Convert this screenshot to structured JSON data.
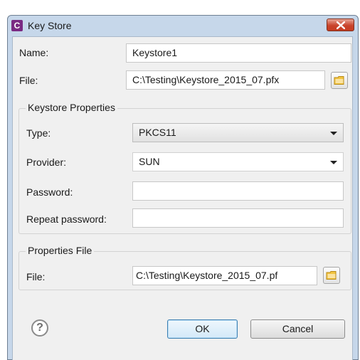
{
  "window": {
    "title": "Key Store",
    "app_icon_letter": "C"
  },
  "form": {
    "name_label": "Name:",
    "name_value": "Keystore1",
    "file_label": "File:",
    "file_value": "C:\\Testing\\Keystore_2015_07.pfx"
  },
  "keystore_properties": {
    "title": "Keystore Properties",
    "type_label": "Type:",
    "type_value": "PKCS11",
    "provider_label": "Provider:",
    "provider_value": "SUN",
    "password_label": "Password:",
    "password_value": "",
    "repeat_password_label": "Repeat password:",
    "repeat_password_value": ""
  },
  "properties_file": {
    "title": "Properties File",
    "file_label": "File:",
    "file_value": "C:\\Testing\\Keystore_2015_07.pf"
  },
  "buttons": {
    "help": "?",
    "ok": "OK",
    "cancel": "Cancel"
  },
  "icons": {
    "app": "app-icon",
    "close": "close-icon",
    "folder": "folder-icon",
    "help": "help-icon",
    "dropdown": "chevron-down-icon"
  },
  "colors": {
    "titlebar": "#c6d7ea",
    "client": "#f0f0f0",
    "close": "#c9452c",
    "ok_border": "#3c7fb1",
    "folder": "#f2c440"
  }
}
